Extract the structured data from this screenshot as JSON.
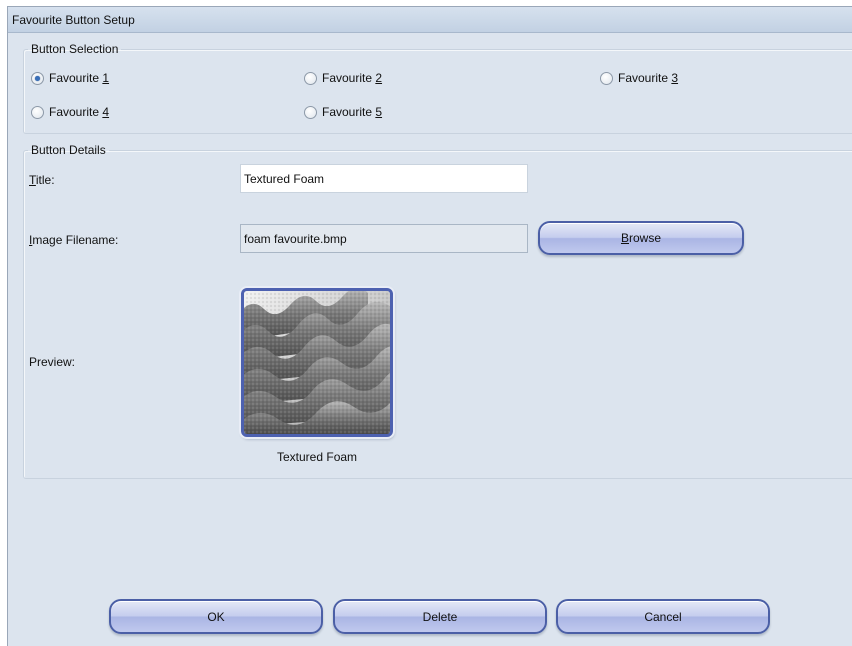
{
  "window": {
    "title": "Favourite Button Setup"
  },
  "button_selection": {
    "legend": "Button Selection",
    "options": [
      {
        "label": "Favourite ",
        "key": "1",
        "checked": true
      },
      {
        "label": "Favourite ",
        "key": "2",
        "checked": false
      },
      {
        "label": "Favourite ",
        "key": "3",
        "checked": false
      },
      {
        "label": "Favourite ",
        "key": "4",
        "checked": false
      },
      {
        "label": "Favourite ",
        "key": "5",
        "checked": false
      }
    ]
  },
  "button_details": {
    "legend": "Button Details",
    "title_label_key": "T",
    "title_label_rest": "itle:",
    "title_value": "Textured Foam",
    "image_label_key": "I",
    "image_label_rest": "mage Filename:",
    "image_value": "foam favourite.bmp",
    "browse_key": "B",
    "browse_rest": "rowse",
    "preview_label": "Preview:",
    "preview_caption": "Textured Foam",
    "preview_icon": "textured-foam-image"
  },
  "footer": {
    "ok_label": "OK",
    "delete_label": "Delete",
    "cancel_label": "Cancel"
  },
  "colors": {
    "window_bg": "#dce4ee",
    "button_border": "#4b5fa6",
    "radio_checked": "#3a6fb8"
  }
}
